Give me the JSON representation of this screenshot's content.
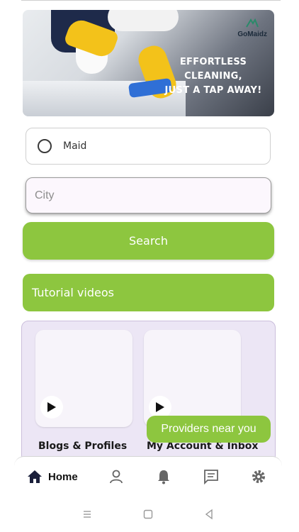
{
  "banner": {
    "brand_name": "GoMaidz",
    "tagline_line1": "EFFORTLESS CLEANING,",
    "tagline_line2": "JUST A TAP AWAY!"
  },
  "service": {
    "selected_label": "Maid"
  },
  "city": {
    "placeholder": "City",
    "value": ""
  },
  "search": {
    "label": "Search"
  },
  "tutorials": {
    "title": "Tutorial videos",
    "videos": [
      {
        "title": "Blogs & Profiles"
      },
      {
        "title": "My Account & Inbox"
      }
    ]
  },
  "providers_chip": {
    "label": "Providers near you"
  },
  "bottom_nav": {
    "items": [
      {
        "label": "Home",
        "icon": "home-icon",
        "active": true
      },
      {
        "icon": "profile-icon"
      },
      {
        "icon": "bell-icon"
      },
      {
        "icon": "chat-icon"
      },
      {
        "icon": "gear-icon"
      }
    ]
  },
  "system_nav": {
    "icons": [
      "recent-apps-icon",
      "home-square-icon",
      "back-icon"
    ]
  },
  "colors": {
    "accent": "#8dc63f",
    "panel": "#ece6f5"
  }
}
